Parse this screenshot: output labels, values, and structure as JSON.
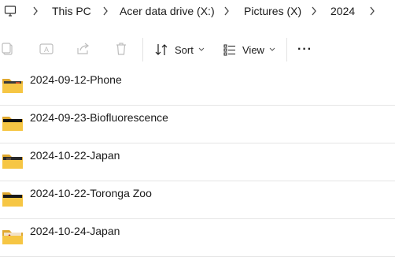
{
  "breadcrumb": {
    "root_icon": "monitor-icon",
    "items": [
      "This PC",
      "Acer data drive (X:)",
      "Pictures (X)",
      "2024"
    ]
  },
  "toolbar": {
    "copy_icon": "copy-icon",
    "rename_icon": "rename-icon",
    "share_icon": "share-icon",
    "delete_icon": "delete-icon",
    "sort_label": "Sort",
    "view_label": "View",
    "more_label": "···"
  },
  "files": [
    {
      "name": "2024-09-12-Phone",
      "icon": "folder-icon"
    },
    {
      "name": "2024-09-23-Biofluorescence",
      "icon": "folder-icon"
    },
    {
      "name": "2024-10-22-Japan",
      "icon": "folder-icon"
    },
    {
      "name": "2024-10-22-Toronga Zoo",
      "icon": "folder-icon"
    },
    {
      "name": "2024-10-24-Japan",
      "icon": "folder-icon"
    }
  ],
  "colors": {
    "folder": "#f6c644",
    "folder_dark": "#e0a82e",
    "accent": "#0067c0"
  }
}
